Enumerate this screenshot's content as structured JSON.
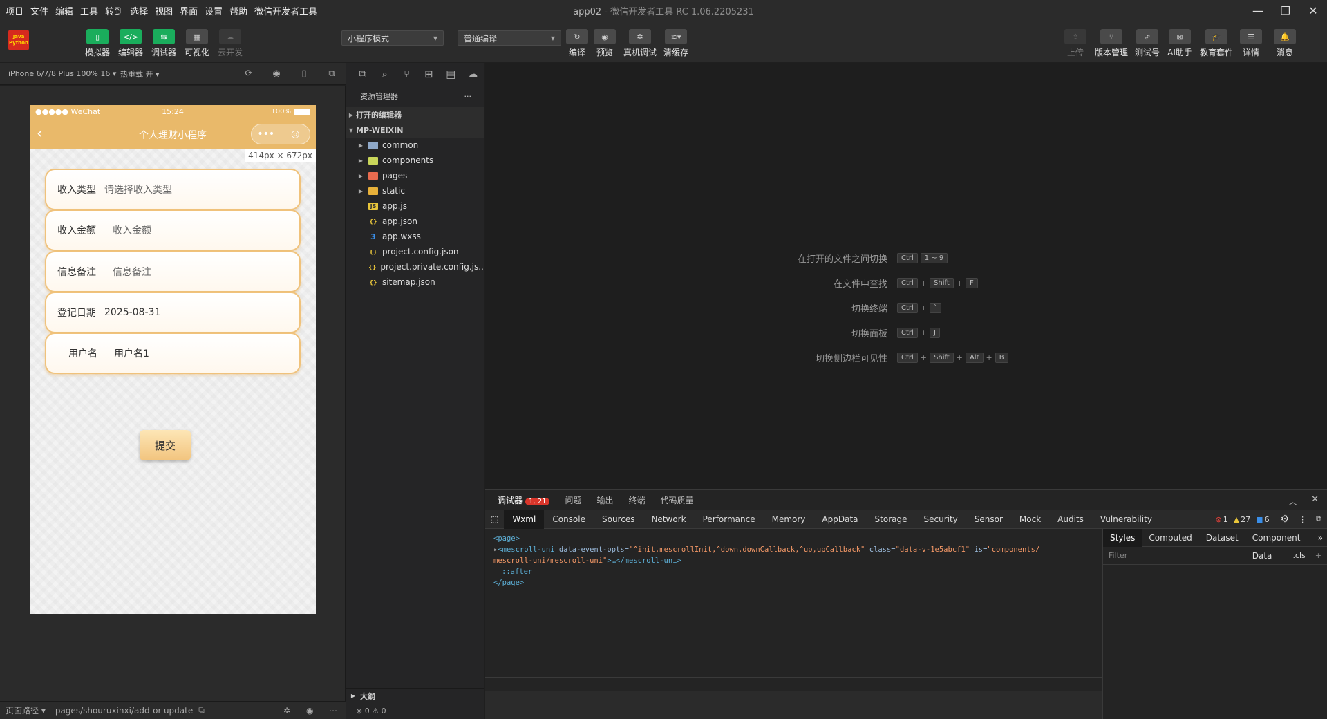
{
  "menu": [
    "项目",
    "文件",
    "编辑",
    "工具",
    "转到",
    "选择",
    "视图",
    "界面",
    "设置",
    "帮助",
    "微信开发者工具"
  ],
  "window": {
    "project": "app02",
    "title": " - 微信开发者工具 RC 1.06.2205231"
  },
  "logo": {
    "line1": "Java",
    "line2": "Python"
  },
  "toolbar": {
    "simulator": "模拟器",
    "editor": "编辑器",
    "debugger": "调试器",
    "visual": "可视化",
    "cloud": "云开发",
    "mode": "小程序模式",
    "compile_mode": "普通编译",
    "compile": "编译",
    "preview": "预览",
    "remote_debug": "真机调试",
    "clear_cache": "清缓存",
    "upload": "上传",
    "version": "版本管理",
    "test_account": "测试号",
    "ai": "AI助手",
    "edu": "教育套件",
    "details": "详情",
    "messages": "消息"
  },
  "sim": {
    "device": "iPhone 6/7/8 Plus 100% 16 ▾",
    "hot_reload": "热重载 开 ▾",
    "path_label": "页面路径 ▾",
    "path": "pages/shouruxinxi/add-or-update"
  },
  "phone": {
    "carrier": "●●●●● WeChat",
    "time": "15:24",
    "battery": "100%",
    "nav_title": "个人理财小程序",
    "dims": "414px × 672px",
    "fields": [
      {
        "label": "收入类型",
        "value": "请选择收入类型"
      },
      {
        "label": "收入金额",
        "value": "收入金额"
      },
      {
        "label": "信息备注",
        "value": "信息备注"
      },
      {
        "label": "登记日期",
        "value": "2025-08-31"
      },
      {
        "label": "用户名",
        "value": "用户名1"
      }
    ],
    "submit": "提交"
  },
  "explorer": {
    "title": "资源管理器",
    "open_editors": "打开的编辑器",
    "root": "MP-WEIXIN",
    "items": [
      {
        "name": "common",
        "type": "folder"
      },
      {
        "name": "components",
        "type": "folder"
      },
      {
        "name": "pages",
        "type": "folder"
      },
      {
        "name": "static",
        "type": "folder"
      },
      {
        "name": "app.js",
        "type": "js"
      },
      {
        "name": "app.json",
        "type": "json"
      },
      {
        "name": "app.wxss",
        "type": "wxss"
      },
      {
        "name": "project.config.json",
        "type": "json"
      },
      {
        "name": "project.private.config.js...",
        "type": "json"
      },
      {
        "name": "sitemap.json",
        "type": "json"
      }
    ],
    "outline": "大纲",
    "status": "⊗ 0 ⚠ 0"
  },
  "shortcuts": [
    {
      "label": "在打开的文件之间切换",
      "keys": [
        "Ctrl",
        "1 ~ 9"
      ]
    },
    {
      "label": "在文件中查找",
      "keys": [
        "Ctrl",
        "Shift",
        "F"
      ]
    },
    {
      "label": "切换终端",
      "keys": [
        "Ctrl",
        "`"
      ]
    },
    {
      "label": "切换面板",
      "keys": [
        "Ctrl",
        "J"
      ]
    },
    {
      "label": "切换侧边栏可见性",
      "keys": [
        "Ctrl",
        "Shift",
        "Alt",
        "B"
      ]
    }
  ],
  "debug": {
    "tabs": [
      "调试器",
      "问题",
      "输出",
      "终端",
      "代码质量"
    ],
    "badge": "1, 21",
    "devtools_tabs": [
      "Wxml",
      "Console",
      "Sources",
      "Network",
      "Performance",
      "Memory",
      "AppData",
      "Storage",
      "Security",
      "Sensor",
      "Mock",
      "Audits",
      "Vulnerability"
    ],
    "errors": "1",
    "warnings": "27",
    "infos": "6",
    "code": {
      "l1": "<page>",
      "tag_open": "<mescroll-uni",
      "attr1": "data-event-opts=",
      "val1": "\"^init,mescrollInit,^down,downCallback,^up,upCallback\"",
      "attr2": "class=",
      "val2": "\"data-v-1e5abcf1\"",
      "attr3": "is=",
      "val3": "\"components/",
      "val3b": "mescroll-uni/mescroll-uni\"",
      "close": ">…</mescroll-uni>",
      "after": "::after",
      "end": "</page>"
    },
    "styles_tabs": [
      "Styles",
      "Computed",
      "Dataset",
      "Component Data"
    ],
    "filter": "Filter",
    "cls": ".cls"
  }
}
